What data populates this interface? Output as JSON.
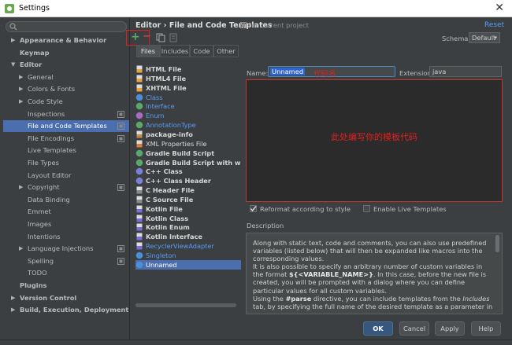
{
  "window": {
    "title": "Settings",
    "close_glyph": "✕"
  },
  "sidebar": {
    "search_placeholder": "",
    "items": [
      {
        "label": "Appearance & Behavior",
        "bold": true,
        "arrow": "right",
        "indent": 0
      },
      {
        "label": "Keymap",
        "bold": true,
        "arrow": "",
        "indent": 0
      },
      {
        "label": "Editor",
        "bold": true,
        "arrow": "down",
        "indent": 0
      },
      {
        "label": "General",
        "bold": false,
        "arrow": "right",
        "indent": 1
      },
      {
        "label": "Colors & Fonts",
        "bold": false,
        "arrow": "right",
        "indent": 1
      },
      {
        "label": "Code Style",
        "bold": false,
        "arrow": "right",
        "indent": 1
      },
      {
        "label": "Inspections",
        "bold": false,
        "arrow": "",
        "indent": 1,
        "project_icon": true
      },
      {
        "label": "File and Code Templates",
        "bold": false,
        "arrow": "",
        "indent": 1,
        "project_icon": true,
        "selected": true
      },
      {
        "label": "File Encodings",
        "bold": false,
        "arrow": "",
        "indent": 1,
        "project_icon": true
      },
      {
        "label": "Live Templates",
        "bold": false,
        "arrow": "",
        "indent": 1
      },
      {
        "label": "File Types",
        "bold": false,
        "arrow": "",
        "indent": 1
      },
      {
        "label": "Layout Editor",
        "bold": false,
        "arrow": "",
        "indent": 1
      },
      {
        "label": "Copyright",
        "bold": false,
        "arrow": "right",
        "indent": 1,
        "project_icon": true
      },
      {
        "label": "Data Binding",
        "bold": false,
        "arrow": "",
        "indent": 1
      },
      {
        "label": "Emmet",
        "bold": false,
        "arrow": "",
        "indent": 1
      },
      {
        "label": "Images",
        "bold": false,
        "arrow": "",
        "indent": 1
      },
      {
        "label": "Intentions",
        "bold": false,
        "arrow": "",
        "indent": 1
      },
      {
        "label": "Language Injections",
        "bold": false,
        "arrow": "right",
        "indent": 1,
        "project_icon": true
      },
      {
        "label": "Spelling",
        "bold": false,
        "arrow": "",
        "indent": 1,
        "project_icon": true
      },
      {
        "label": "TODO",
        "bold": false,
        "arrow": "",
        "indent": 1
      },
      {
        "label": "Plugins",
        "bold": true,
        "arrow": "",
        "indent": 0
      },
      {
        "label": "Version Control",
        "bold": true,
        "arrow": "right",
        "indent": 0
      },
      {
        "label": "Build, Execution, Deployment",
        "bold": true,
        "arrow": "right",
        "indent": 0
      }
    ]
  },
  "header": {
    "breadcrumb": "Editor › File and Code Templates",
    "project_note": "For current project",
    "reset_label": "Reset",
    "schema_label": "Schema:",
    "schema_value": "Default"
  },
  "toolbar": {
    "add_glyph": "+",
    "remove_glyph": "−"
  },
  "tabs": [
    "Files",
    "Includes",
    "Code",
    "Other"
  ],
  "files": [
    {
      "label": "HTML File",
      "style": "bold",
      "icon": "html-file-icon"
    },
    {
      "label": "HTML4 File",
      "style": "bold",
      "icon": "html-file-icon"
    },
    {
      "label": "XHTML File",
      "style": "bold",
      "icon": "html-file-icon"
    },
    {
      "label": "Class",
      "style": "blue",
      "icon": "class-icon"
    },
    {
      "label": "Interface",
      "style": "blue",
      "icon": "interface-icon"
    },
    {
      "label": "Enum",
      "style": "blue",
      "icon": "enum-icon"
    },
    {
      "label": "AnnotationType",
      "style": "blue",
      "icon": "annotation-icon"
    },
    {
      "label": "package-info",
      "style": "bold",
      "icon": "java-file-icon"
    },
    {
      "label": "XML Properties File",
      "style": "normal",
      "icon": "xml-file-icon"
    },
    {
      "label": "Gradle Build Script",
      "style": "bold",
      "icon": "gradle-icon"
    },
    {
      "label": "Gradle Build Script with wrappe",
      "style": "bold",
      "icon": "gradle-icon"
    },
    {
      "label": "C++ Class",
      "style": "bold",
      "icon": "cpp-class-icon"
    },
    {
      "label": "C++ Class Header",
      "style": "bold",
      "icon": "cpp-class-icon"
    },
    {
      "label": "C Header File",
      "style": "bold",
      "icon": "c-file-icon"
    },
    {
      "label": "C Source File",
      "style": "bold",
      "icon": "c-file-icon"
    },
    {
      "label": "Kotlin File",
      "style": "bold",
      "icon": "kotlin-file-icon"
    },
    {
      "label": "Kotlin Class",
      "style": "bold",
      "icon": "kotlin-file-icon"
    },
    {
      "label": "Kotlin Enum",
      "style": "bold",
      "icon": "kotlin-file-icon"
    },
    {
      "label": "Kotlin Interface",
      "style": "bold",
      "icon": "kotlin-file-icon"
    },
    {
      "label": "RecyclerViewAdapter",
      "style": "blue",
      "icon": "kotlin-file-icon"
    },
    {
      "label": "Singleton",
      "style": "blue",
      "icon": "class-icon"
    },
    {
      "label": "Unnamed",
      "style": "selected",
      "icon": "class-icon"
    }
  ],
  "form": {
    "name_label": "Name:",
    "name_value": "Unnamed",
    "name_annotation": "代码名",
    "extension_label": "Extension:",
    "extension_value": "java",
    "editor_annotation": "此处编写你的模板代码",
    "reformat_label": "Reformat according to style",
    "reformat_checked": true,
    "live_templates_label": "Enable Live Templates",
    "live_templates_checked": false
  },
  "description": {
    "label": "Description",
    "p1": "Along with static text, code and comments, you can also use predefined variables (listed below) that will then be expanded like macros into the corresponding values.",
    "p2a": "It is also possible to specify an arbitrary number of custom variables in the format ",
    "p2b": "${<VARIABLE_NAME>}",
    "p2c": ". In this case, before the new file is created, you will be prompted with a dialog where you can define particular values for all custom variables.",
    "p3a": "Using the ",
    "p3b": "#parse",
    "p3c": " directive, you can include templates from the ",
    "p3d": "Includes",
    "p3e": " tab, by specifying the full name of the desired template as a parameter in"
  },
  "buttons": {
    "ok": "OK",
    "cancel": "Cancel",
    "apply": "Apply",
    "help": "Help"
  },
  "colors": {
    "selection": "#4b6eaf",
    "link": "#589df6",
    "annotation": "#e02020",
    "add": "#59a869"
  }
}
